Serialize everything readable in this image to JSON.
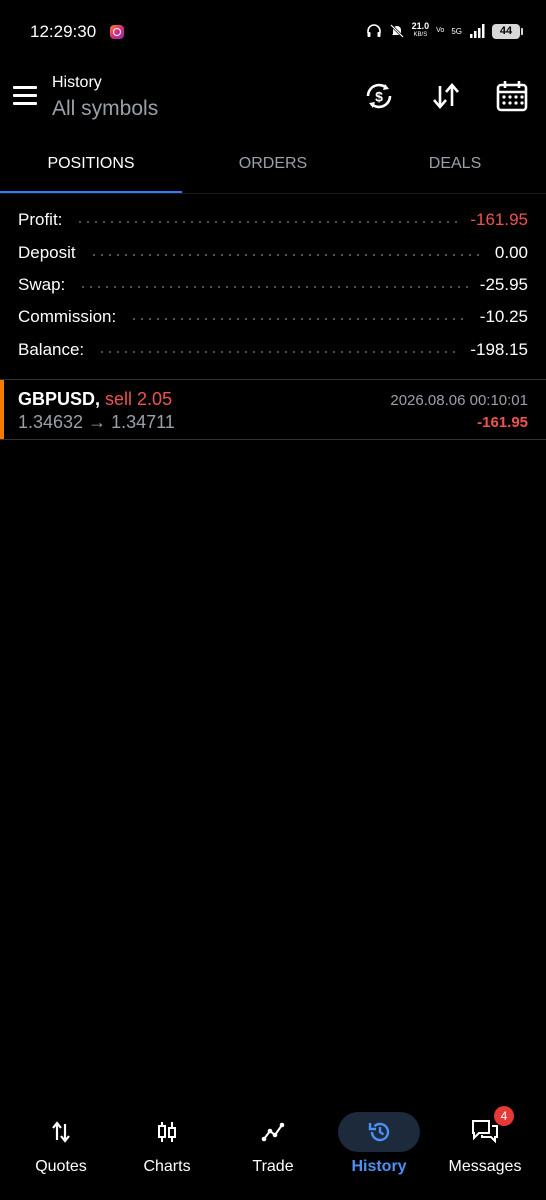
{
  "status_bar": {
    "time": "12:29:30",
    "network_speed": "21.0",
    "network_speed_unit": "KB/S",
    "network_type": "5G",
    "volte_label": "Vo",
    "battery": "44"
  },
  "header": {
    "title": "History",
    "subtitle": "All symbols"
  },
  "tabs": [
    {
      "label": "POSITIONS",
      "active": true
    },
    {
      "label": "ORDERS",
      "active": false
    },
    {
      "label": "DEALS",
      "active": false
    }
  ],
  "summary": [
    {
      "label": "Profit:",
      "value": "-161.95",
      "color": "#ef5350"
    },
    {
      "label": "Deposit",
      "value": "0.00",
      "color": "#ffffff"
    },
    {
      "label": "Swap:",
      "value": "-25.95",
      "color": "#ffffff"
    },
    {
      "label": "Commission:",
      "value": "-10.25",
      "color": "#ffffff"
    },
    {
      "label": "Balance:",
      "value": "-198.15",
      "color": "#ffffff"
    }
  ],
  "positions": [
    {
      "symbol": "GBPUSD,",
      "side": "sell 2.05",
      "prices": "1.34632 → 1.34711",
      "time": "2026.08.06 00:10:01",
      "profit": "-161.95"
    }
  ],
  "bottom_nav": [
    {
      "label": "Quotes",
      "icon": "quotes-arrows-icon",
      "active": false
    },
    {
      "label": "Charts",
      "icon": "candlestick-icon",
      "active": false
    },
    {
      "label": "Trade",
      "icon": "trade-line-icon",
      "active": false
    },
    {
      "label": "History",
      "icon": "history-clock-icon",
      "active": true
    },
    {
      "label": "Messages",
      "icon": "messages-icon",
      "active": false,
      "badge": "4"
    }
  ],
  "colors": {
    "accent": "#2f7ef5",
    "negative": "#ef5350",
    "position_marker": "#f57c00",
    "muted": "#9aa0a8"
  }
}
